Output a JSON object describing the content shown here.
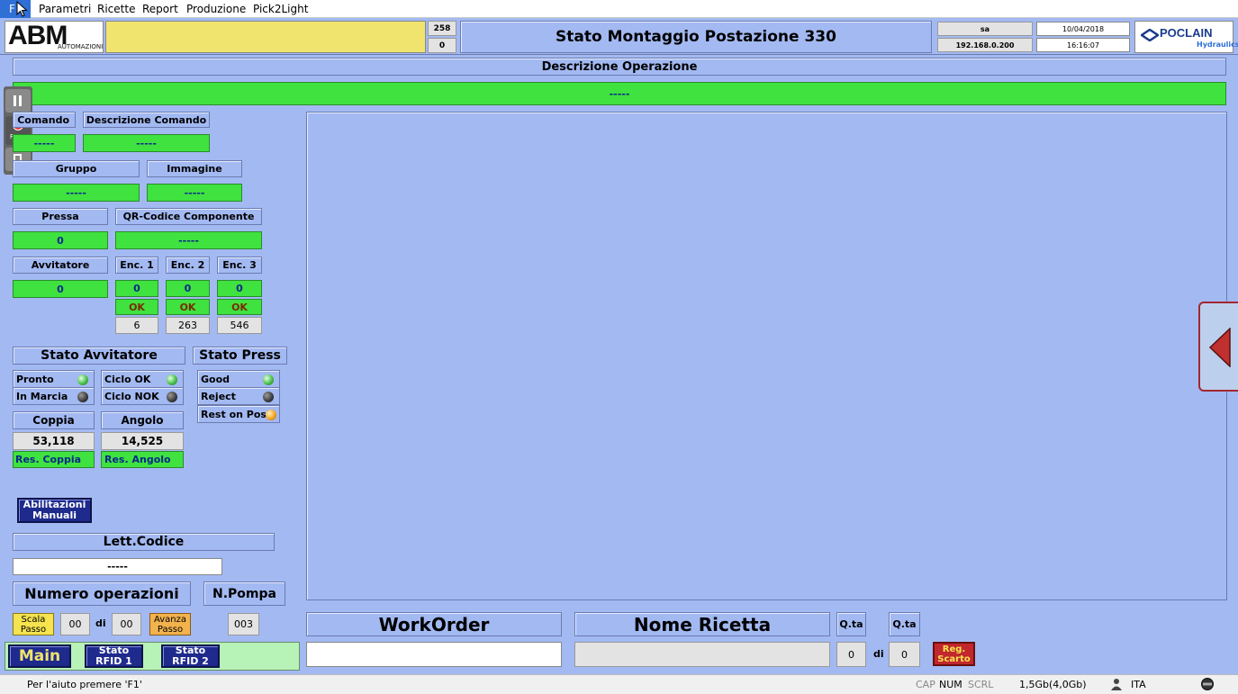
{
  "menu": {
    "items": [
      "Parametri",
      "Ricette",
      "Report",
      "Produzione",
      "Pick2Light"
    ],
    "f_label": "F"
  },
  "header": {
    "logo_text": "ABM",
    "logo_sub": "AUTOMAZIONI",
    "counter_top": "258",
    "counter_bottom": "0",
    "title": "Stato Montaggio Postazione 330",
    "user": "sa",
    "ip": "192.168.0.200",
    "date": "10/04/2018",
    "time": "16:16:07",
    "brand": "POCLAIN",
    "brand_sub": "Hydraulics"
  },
  "operation": {
    "title": "Descrizione Operazione",
    "value": "-----"
  },
  "left": {
    "comando_label": "Comando",
    "comando_value": "-----",
    "desc_comando_label": "Descrizione Comando",
    "desc_comando_value": "-----",
    "gruppo_label": "Gruppo",
    "gruppo_value": "-----",
    "immagine_label": "Immagine",
    "immagine_value": "-----",
    "pressa_label": "Pressa",
    "pressa_value": "0",
    "qr_label": "QR-Codice Componente",
    "qr_value": "-----",
    "avvitatore_label": "Avvitatore",
    "avvitatore_value": "0",
    "enc": [
      {
        "label": "Enc. 1",
        "value": "0",
        "status": "OK",
        "count": "6"
      },
      {
        "label": "Enc. 2",
        "value": "0",
        "status": "OK",
        "count": "263"
      },
      {
        "label": "Enc. 3",
        "value": "0",
        "status": "OK",
        "count": "546"
      }
    ],
    "stato_avvitatore_title": "Stato Avvitatore",
    "stato_press_title": "Stato Press",
    "pronto": "Pronto",
    "in_marcia": "In Marcia",
    "ciclo_ok": "Ciclo OK",
    "ciclo_nok": "Ciclo NOK",
    "good": "Good",
    "reject": "Reject",
    "rest_on_pos": "Rest on Pos.",
    "coppia_label": "Coppia",
    "coppia_value": "53,118",
    "angolo_label": "Angolo",
    "angolo_value": "14,525",
    "res_coppia": "Res. Coppia",
    "res_angolo": "Res. Angolo",
    "abilitazioni": "Abilitazioni Manuali",
    "lett_codice_label": "Lett.Codice",
    "lett_codice_value": "-----",
    "num_operazioni_label": "Numero operazioni",
    "n_pompa_label": "N.Pompa",
    "scala_passo": "Scala Passo",
    "step_current": "00",
    "di": "di",
    "step_total": "00",
    "avanza_passo": "Avanza Passo",
    "n_pompa_value": "003"
  },
  "bottom": {
    "main": "Main",
    "stato_rfid1": "Stato RFID 1",
    "stato_rfid2": "Stato RFID 2",
    "workorder_label": "WorkOrder",
    "workorder_value": "",
    "nome_ricetta_label": "Nome Ricetta",
    "nome_ricetta_value": "",
    "qta_label": "Q.ta",
    "qta_label2": "Q.ta",
    "qta_value": "0",
    "qta_di": "di",
    "qta_total": "0",
    "reg_scarto": "Reg. Scarto"
  },
  "statusbar": {
    "help": "Per l'aiuto premere 'F1'",
    "cap": "CAP",
    "num": "NUM",
    "scrl": "SCRL",
    "memory": "1,5Gb(4,0Gb)",
    "lang": "ITA"
  },
  "side_toolbar": {
    "f11": "F11"
  },
  "colors": {
    "background": "#a3b9f2",
    "green": "#3fe23f",
    "yellow": "#f0e46e",
    "dark_button": "#1e2a8c"
  }
}
